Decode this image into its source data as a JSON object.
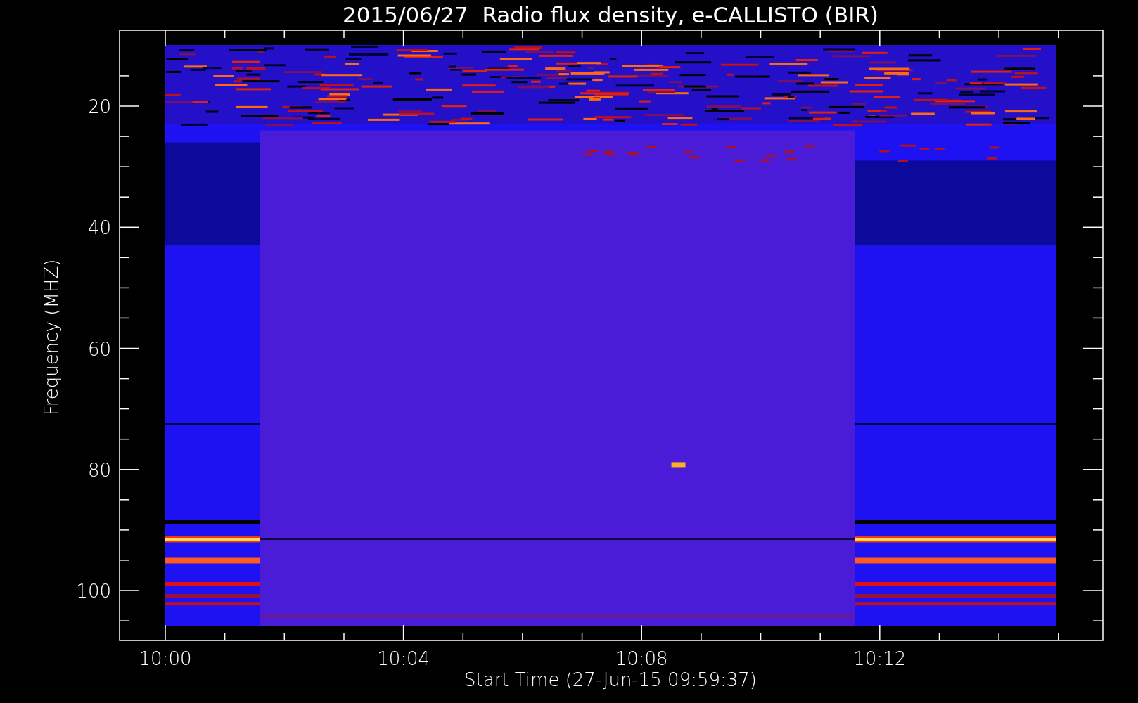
{
  "title": "2015/06/27  Radio flux density, e-CALLISTO (BIR)",
  "plot": {
    "ylabel": "Frequency (MHZ)",
    "xlabel": "Start Time (27-Jun-15 09:59:37)",
    "yticks": [
      "20",
      "40",
      "60",
      "80",
      "100"
    ],
    "xticks": [
      "10:00",
      "10:04",
      "10:08",
      "10:12"
    ]
  }
}
